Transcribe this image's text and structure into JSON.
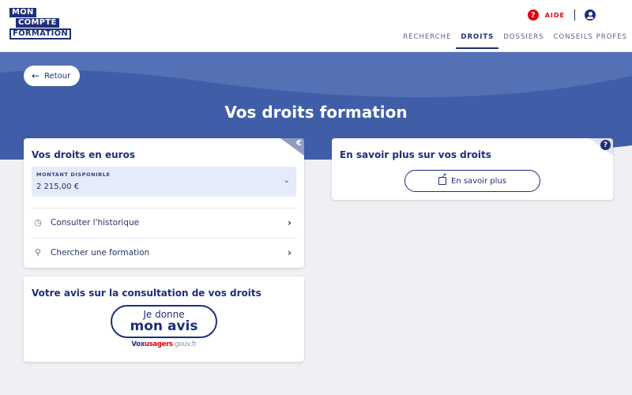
{
  "logo": {
    "line1": "MON",
    "line2": "COMPTE",
    "line3": "FORMATION"
  },
  "header": {
    "help_label": "AIDE",
    "help_icon": "?",
    "nav": [
      {
        "label": "RECHERCHE"
      },
      {
        "label": "DROITS"
      },
      {
        "label": "DOSSIERS"
      },
      {
        "label": "CONSEILS PROFES"
      }
    ]
  },
  "banner": {
    "back_label": "Retour",
    "back_icon": "←",
    "title": "Vos droits formation"
  },
  "droits": {
    "title": "Vos droits en euros",
    "corner_icon": "€",
    "amount_label": "MONTANT DISPONIBLE",
    "amount_value": "2 215,00 €",
    "chevron": "⌄",
    "history_icon": "◷",
    "history_label": "Consulter l'historique",
    "search_icon": "⚲",
    "search_label": "Chercher une formation",
    "row_chevron": "›"
  },
  "info": {
    "title": "En savoir plus sur vos droits",
    "corner_icon": "?",
    "button_label": "En savoir plus"
  },
  "avis": {
    "title": "Votre avis sur la consultation de vos droits",
    "button_line1": "Je donne",
    "button_line2": "mon avis",
    "brand_a": "Vox",
    "brand_b": "usagers",
    "brand_c": ".gouv.fr"
  },
  "colors": {
    "primary": "#1e2f7a",
    "banner": "#3f5ea7",
    "accent_red": "#e1000f",
    "page_bg": "#f0f0f4"
  }
}
